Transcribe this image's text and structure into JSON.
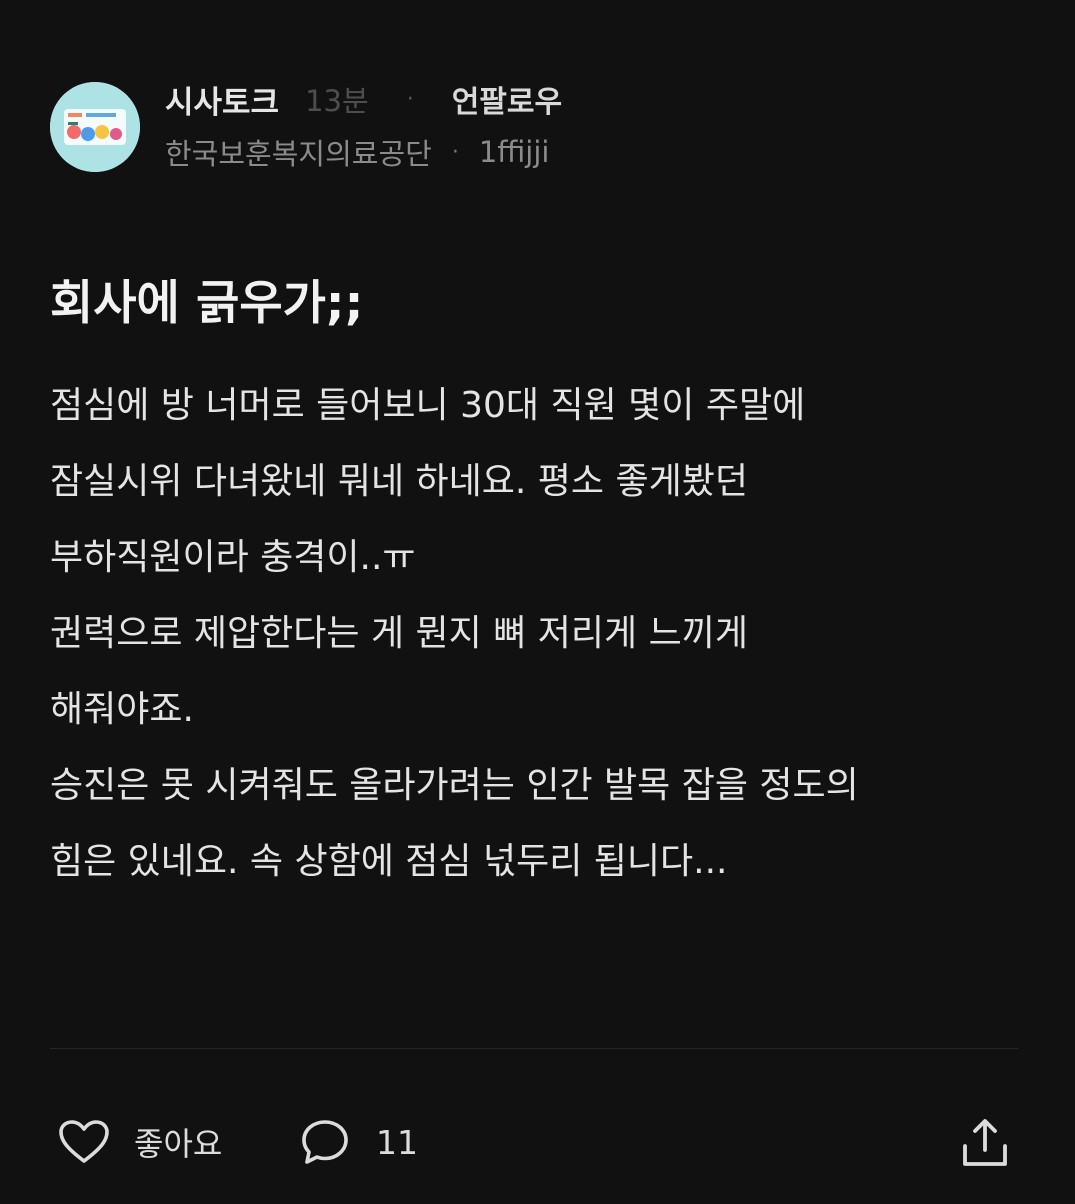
{
  "post": {
    "channel": "시사토크",
    "time_ago": "13분",
    "unfollow_label": "언팔로우",
    "company": "한국보훈복지의료공단",
    "author_id": "1ffijji",
    "title": "회사에 긁우가;;",
    "body_lines": [
      "점심에 방 너머로 들어보니 30대 직원 몇이 주말에",
      "잠실시위 다녀왔네 뭐네 하네요. 평소 좋게봤던",
      "부하직원이라 충격이..ㅠ",
      "권력으로 제압한다는 게 뭔지 뼈 저리게 느끼게",
      "해줘야죠.",
      "승진은 못 시켜줘도 올라가려는 인간 발목 잡을 정도의",
      "힘은 있네요. 속 상함에 점심 넋두리 됩니다..."
    ]
  },
  "actions": {
    "like_icon": "heart-icon",
    "like_label": "좋아요",
    "comment_icon": "speech-bubble-icon",
    "comment_count": "11",
    "share_icon": "share-upload-icon"
  },
  "colors": {
    "background": "#111111",
    "text_primary": "#e4e4e4",
    "text_muted": "#8b8b8b",
    "avatar_bg": "#aee3e6"
  }
}
